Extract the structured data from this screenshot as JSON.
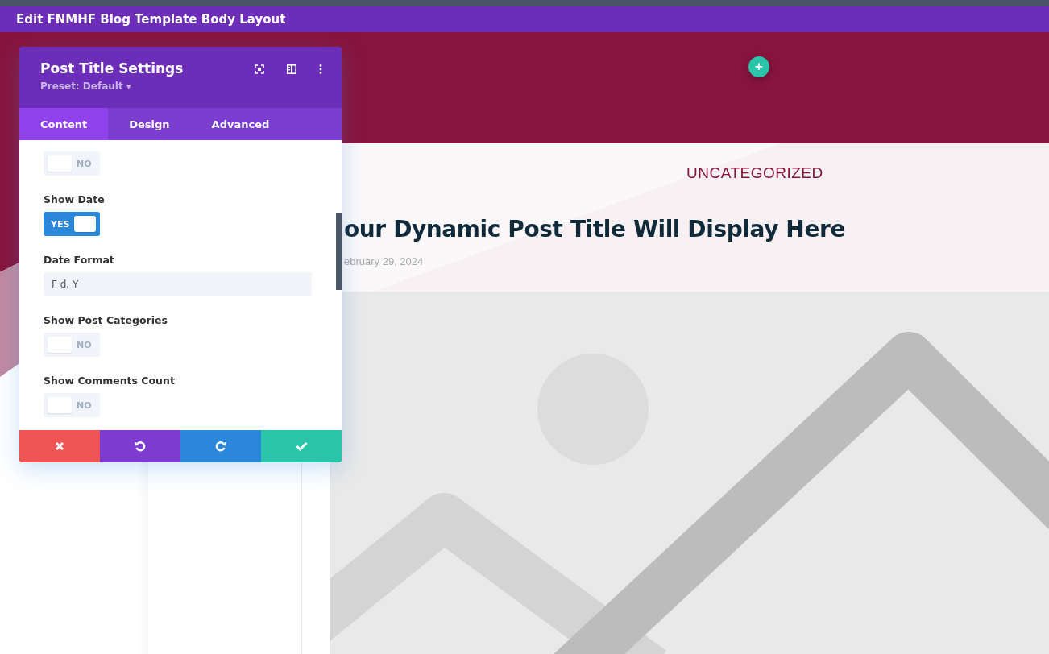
{
  "window": {
    "title": "Edit FNMHF Blog Template Body Layout"
  },
  "settings_panel": {
    "title": "Post Title Settings",
    "preset": "Preset: Default",
    "preset_caret": "▾",
    "tabs": [
      {
        "label": "Content",
        "selected": true
      },
      {
        "label": "Design",
        "selected": false
      },
      {
        "label": "Advanced",
        "selected": false
      }
    ],
    "fields": [
      {
        "kind": "toggle",
        "on": false,
        "state_text": "NO"
      },
      {
        "kind": "toggle",
        "label": "Show Date",
        "on": true,
        "state_text": "YES"
      },
      {
        "kind": "text",
        "label": "Date Format",
        "value": "F d, Y"
      },
      {
        "kind": "toggle",
        "label": "Show Post Categories",
        "on": false,
        "state_text": "NO"
      },
      {
        "kind": "toggle",
        "label": "Show Comments Count",
        "on": false,
        "state_text": "NO"
      }
    ],
    "actions": [
      {
        "kind": "discard"
      },
      {
        "kind": "undo"
      },
      {
        "kind": "redo"
      },
      {
        "kind": "save"
      }
    ]
  },
  "add_section": {
    "label": "+"
  },
  "post_header": {
    "category": "UNCATEGORIZED",
    "title": "our Dynamic Post Title Will Display Here",
    "date": "ebruary 29, 2024"
  },
  "featured_image": {
    "kind": "placeholder"
  }
}
